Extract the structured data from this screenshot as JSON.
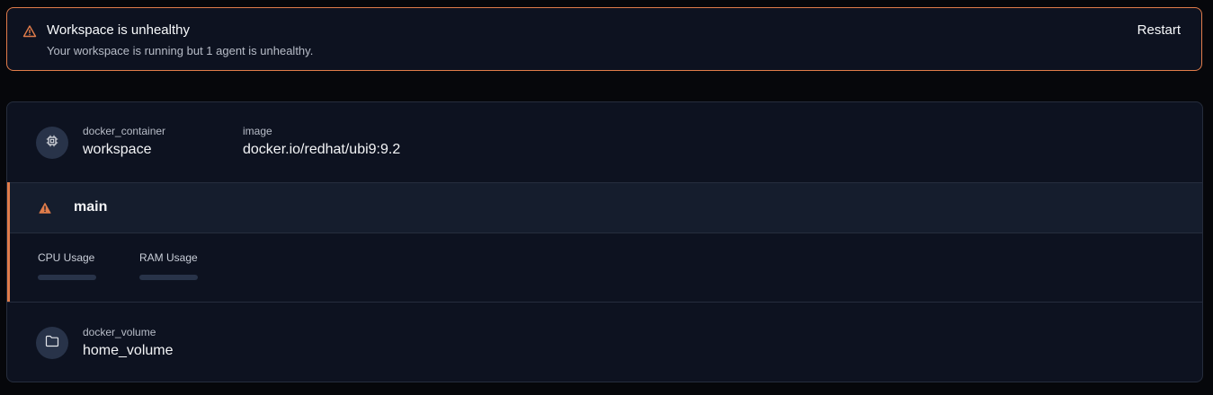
{
  "alert": {
    "title": "Workspace is unhealthy",
    "description": "Your workspace is running but 1 agent is unhealthy.",
    "restart_label": "Restart",
    "icon": "warning-triangle-icon",
    "accent_color": "#e07c4a"
  },
  "resources": {
    "container": {
      "type": "docker_container",
      "name": "workspace",
      "icon": "chip-icon",
      "metadata": {
        "label": "image",
        "value": "docker.io/redhat/ubi9:9.2"
      }
    },
    "agent": {
      "name": "main",
      "status_icon": "warning-icon",
      "status_color": "#e07c4a",
      "metrics": {
        "cpu_label": "CPU Usage",
        "ram_label": "RAM Usage"
      }
    },
    "volume": {
      "type": "docker_volume",
      "name": "home_volume",
      "icon": "folder-icon"
    }
  }
}
